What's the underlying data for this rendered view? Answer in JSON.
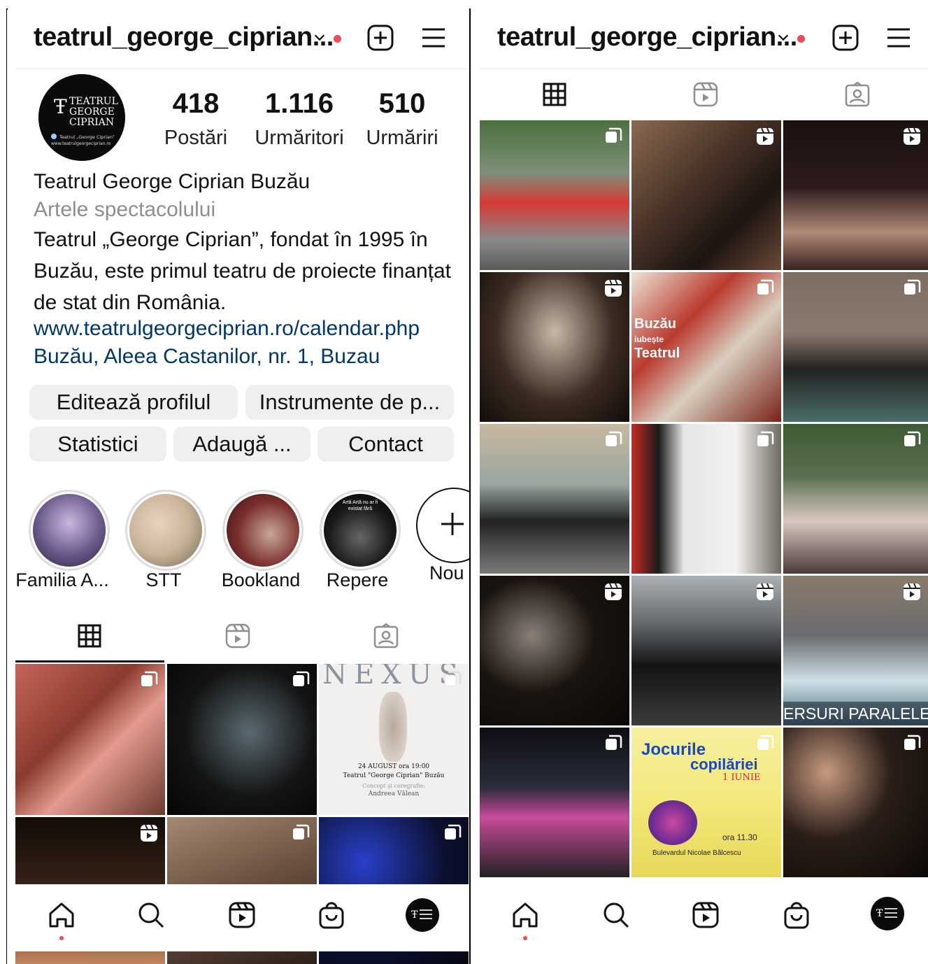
{
  "colors": {
    "accent_red": "#ed4956",
    "link_blue": "#00376b",
    "button_bg": "#efefef"
  },
  "header": {
    "username": "teatrul_george_ciprian...",
    "icons": [
      "chevron-down-icon",
      "notification-dot",
      "new-post-icon",
      "menu-icon"
    ]
  },
  "profile": {
    "avatar": {
      "line1": "TEATRUL",
      "line2": "GEORGE",
      "line3": "CIPRIAN",
      "small1": "Teatrul „George Ciprian”",
      "small2": "www.teatrulgeorgeciprian.ro"
    },
    "stats": [
      {
        "value": "418",
        "label": "Postări"
      },
      {
        "value": "1.116",
        "label": "Urmăritori"
      },
      {
        "value": "510",
        "label": "Urmăriri"
      }
    ],
    "name": "Teatrul George Ciprian Buzău",
    "category": "Artele spectacolului",
    "bio_lines": [
      "Teatrul „George Ciprian”, fondat în 1995 în",
      "Buzău, este primul teatru de proiecte finanțat",
      "de stat din România."
    ],
    "link": "www.teatrulgeorgeciprian.ro/calendar.php",
    "address": "Buzău, Aleea Castanilor, nr. 1, Buzau"
  },
  "buttons": {
    "edit_profile": "Editează profilul",
    "pro_tools": "Instrumente de p...",
    "insights": "Statistici",
    "add": "Adaugă ...",
    "contact": "Contact"
  },
  "highlights": [
    {
      "label": "Familia A...",
      "color": "#6b5a8c"
    },
    {
      "label": "STT",
      "color": "#c9b49a"
    },
    {
      "label": "Bookland",
      "color": "#7a2e2e"
    },
    {
      "label": "Repere",
      "color": "#1a1a1a",
      "text1": "Artă Artă nu ar fi",
      "text2": "existat fără"
    },
    {
      "label": "Nou",
      "icon": "plus-icon"
    }
  ],
  "tabs": [
    "grid-icon",
    "reels-icon",
    "tagged-icon"
  ],
  "left_grid": [
    {
      "type": "carousel",
      "color": "#8a3b2e"
    },
    {
      "type": "carousel",
      "color": "#141414"
    },
    {
      "type": "carousel",
      "color": "#f2f0ee",
      "title": "NEXUS",
      "date": "24 AUGUST ora 19:00",
      "venue": "Teatrul \"George Ciprian\" Buzău",
      "credit1": "Concept și coregrafie:",
      "credit2": "Andreea Vălean"
    },
    {
      "type": "reel",
      "color": "#3a2418"
    },
    {
      "type": "carousel",
      "color": "#6b5140"
    },
    {
      "type": "carousel",
      "color": "#0c1030"
    }
  ],
  "right_grid": [
    {
      "type": "carousel",
      "color": "#7d8f7a"
    },
    {
      "type": "reel",
      "color": "#4a3428"
    },
    {
      "type": "reel",
      "color": "#2e1c1c"
    },
    {
      "type": "reel",
      "color": "#3b2b22"
    },
    {
      "type": "carousel",
      "color": "#b93a2e",
      "text1": "Buzău",
      "text2": "iubește",
      "text3": "Teatrul"
    },
    {
      "type": "carousel",
      "color": "#8b7a6e"
    },
    {
      "type": "carousel",
      "color": "#9aa6a0"
    },
    {
      "type": "carousel",
      "color": "#6e6a62"
    },
    {
      "type": "carousel",
      "color": "#5a7052"
    },
    {
      "type": "reel",
      "color": "#1a1410"
    },
    {
      "type": "reel",
      "color": "#3c3a3a"
    },
    {
      "type": "reel",
      "color": "#6a6c70",
      "caption": "ERSURI PARALELE"
    },
    {
      "type": "carousel",
      "color": "#2a2c3a"
    },
    {
      "type": "carousel",
      "color": "#f2e87a",
      "title1": "Jocurile",
      "title2": "copilăriei",
      "date": "1 IUNIE",
      "time": "ora 11.30",
      "place": "Bulevardul Nicolae Bălcescu"
    },
    {
      "type": "carousel",
      "color": "#2a1e18"
    }
  ],
  "bottom_nav": [
    "home-icon",
    "search-icon",
    "reels-icon",
    "shop-icon",
    "profile-avatar"
  ]
}
